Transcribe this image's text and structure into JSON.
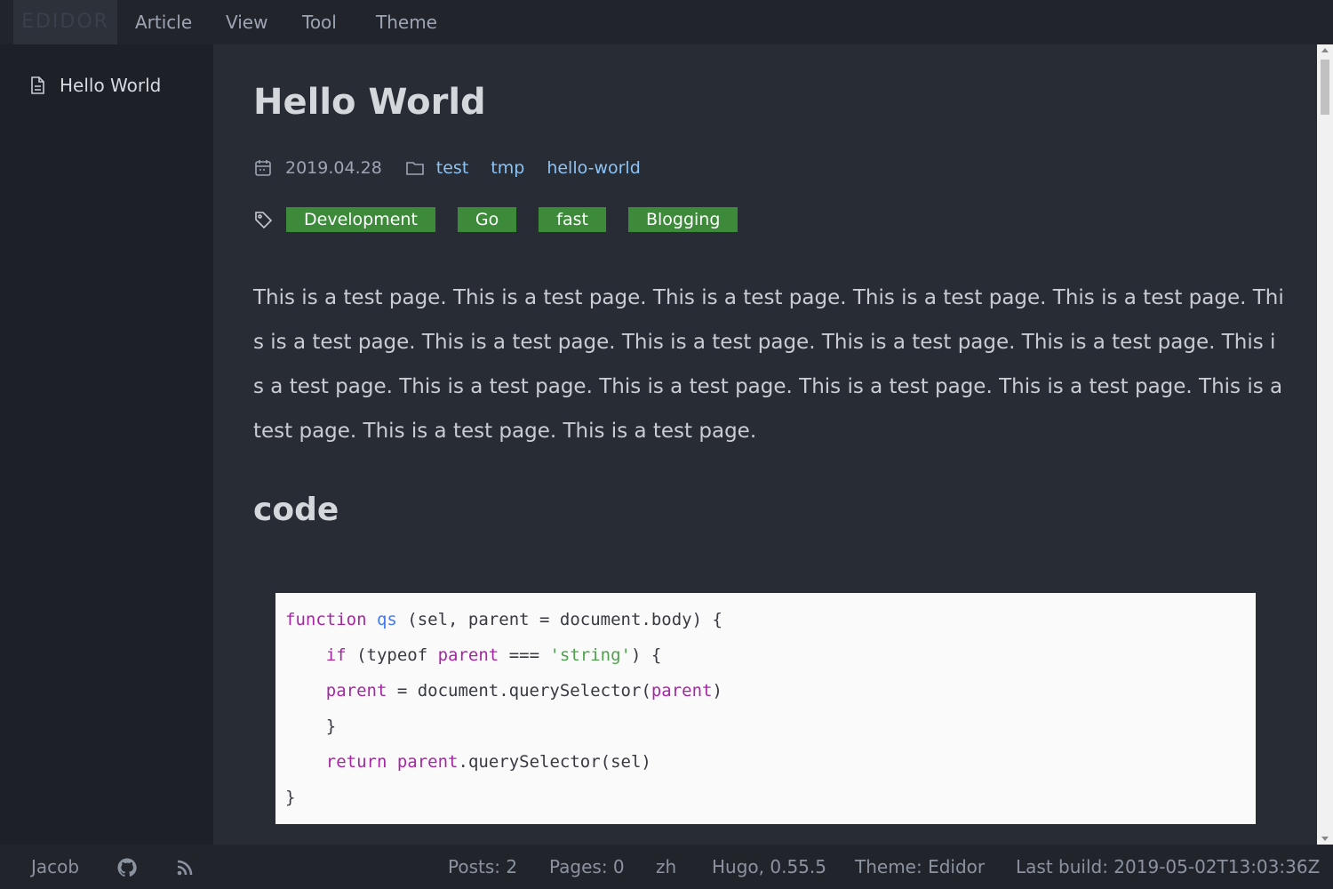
{
  "app": {
    "logo_text": "EDIDOR"
  },
  "menu": {
    "items": [
      {
        "label": "Article"
      },
      {
        "label": "View"
      },
      {
        "label": "Tool"
      },
      {
        "label": "Theme"
      }
    ]
  },
  "sidebar": {
    "items": [
      {
        "label": "Hello World",
        "icon": "file-text-icon"
      }
    ]
  },
  "article": {
    "title": "Hello World",
    "date": "2019.04.28",
    "categories": [
      "test",
      "tmp",
      "hello-world"
    ],
    "tags": [
      "Development",
      "Go",
      "fast",
      "Blogging"
    ],
    "paragraph": "This is a test page. This is a test page. This is a test page. This is a test page. This is a test page. This is a test page. This is a test page. This is a test page. This is a test page. This is a test page. This is a test page. This is a test page. This is a test page. This is a test page. This is a test page. This is a test page. This is a test page. This is a test page.",
    "heading": "code",
    "code_lines": [
      "function qs (sel, parent = document.body) {",
      "    if (typeof parent === 'string') {",
      "    parent = document.querySelector(parent)",
      "    }",
      "    return parent.querySelector(sel)",
      "}"
    ]
  },
  "footer": {
    "author": "Jacob",
    "posts": "Posts: 2",
    "pages": "Pages: 0",
    "lang": "zh",
    "hugo": "Hugo, 0.55.5",
    "theme": "Theme: Edidor",
    "last_build": "Last build: 2019-05-02T13:03:36Z"
  },
  "colors": {
    "background": "#282c34",
    "sidebar": "#1d2026",
    "topbar": "#21252b",
    "tag_bg": "#3c8a3a",
    "link": "#8cc3f7",
    "code_bg": "#fafafa"
  },
  "icons": {
    "date": "calendar-icon",
    "category": "folder-icon",
    "tags": "tag-icon",
    "github": "github-icon",
    "rss": "rss-icon"
  }
}
